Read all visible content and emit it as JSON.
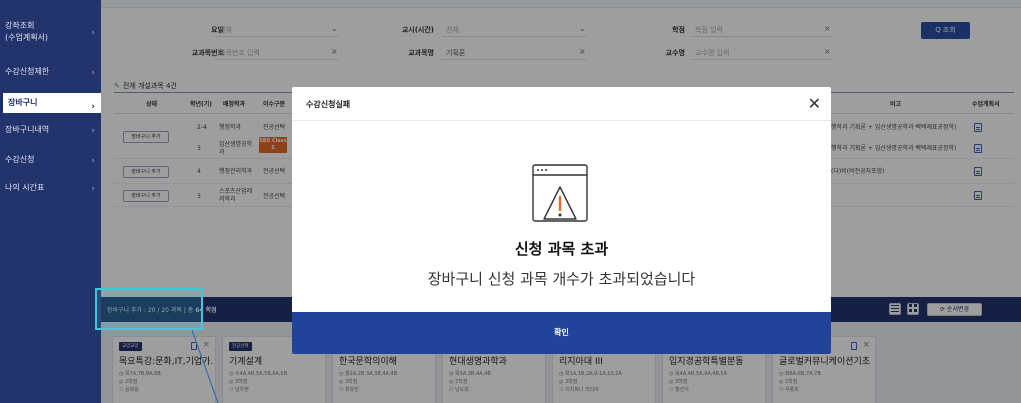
{
  "sidebar": {
    "items": [
      {
        "label": "강좌조회\n(수업계획서)"
      },
      {
        "label": "수강신청제한"
      },
      {
        "label": "장바구니"
      },
      {
        "label": "장바구니내역"
      },
      {
        "label": "수강신청"
      },
      {
        "label": "나의 시간표"
      }
    ]
  },
  "filters": {
    "yoil_label": "요일",
    "yoil_value": "전체",
    "gyosi_label": "교시(시간)",
    "gyosi_value": "전체",
    "hakjeom_label": "학점",
    "hakjeom_placeholder": "학점 입력",
    "code_label": "교과목번호",
    "code_placeholder": "과목번호 입력",
    "name_label": "교과목명",
    "name_value": "기획론",
    "prof_label": "교수명",
    "prof_placeholder": "교수명 입력",
    "search_label": "Q 조회"
  },
  "table": {
    "caption": "전체 개설과목 4건",
    "headers": [
      "상태",
      "학년(기)",
      "배정학과",
      "이수구분",
      "비고",
      "수업계획서"
    ],
    "rows": [
      {
        "btn": "장바구니 추가",
        "grade": "2-4",
        "dept": "행정학과",
        "type": "전공선택",
        "note": "행학과 기획론 + 임산생명공학과 벡택제표공정학)"
      },
      {
        "btn": "장바구니 추가",
        "grade": "3",
        "dept": "임산생명공학\n과",
        "type": "",
        "note": "행학과 기획론 + 임산생명공학과 벡택제표공정학)"
      },
      {
        "btn": "장바구니 추가",
        "grade": "4",
        "dept": "행정관리학과",
        "type": "전공선택",
        "note": "(다)비(비전공자포함)"
      },
      {
        "btn": "장바구니 추가",
        "grade": "3",
        "dept": "스포츠산업레\n저학과",
        "type": "전공선택",
        "note": ""
      }
    ],
    "orange_tag": "SBS Class\nS"
  },
  "cart_bar": {
    "prefix": "장바구니 추가 : 20 / 20 과목  |  총 ",
    "credits": "64 학점",
    "order_label": "순서변경"
  },
  "cards": [
    {
      "tag": "교양교양",
      "title": "목요특강:문화,IT,기업가...",
      "code": "목7A,7B,8A,8B",
      "credit": "2학점",
      "prof": "윤희웅"
    },
    {
      "tag": "전공선택",
      "title": "기계설계",
      "code": "수4A,4B,5A,5B,6A,6B",
      "credit": "3학점",
      "prof": "남우현"
    },
    {
      "tag": "",
      "title": "한국문학의이해",
      "code": "월2A,2B,3A,3B,4A,4B",
      "credit": "3학점",
      "prof": "최유빈"
    },
    {
      "tag": "",
      "title": "현대생명과학과",
      "code": "목3A,3B,4A,4B",
      "credit": "2학점",
      "prof": "남도희"
    },
    {
      "tag": "",
      "title": "리지아대 III",
      "code": "화1A,1B,2A,9-1A,10,2A",
      "credit": "3학점",
      "prof": "이치피니 리디아"
    },
    {
      "tag": "",
      "title": "입지경공학특별분동",
      "code": "목4A,4B,5A,9A,4B,5A",
      "credit": "3학점",
      "prof": "황선익"
    },
    {
      "tag": "",
      "title": "글로벌커뮤니케이션기초",
      "code": "화6A,6B,7A,7B",
      "credit": "2학점",
      "prof": "우종희"
    }
  ],
  "dialog": {
    "title": "수강신청실패",
    "heading": "신청 과목 초과",
    "message": "장바구니 신청 과목 개수가 초과되었습니다",
    "ok_label": "확인"
  }
}
